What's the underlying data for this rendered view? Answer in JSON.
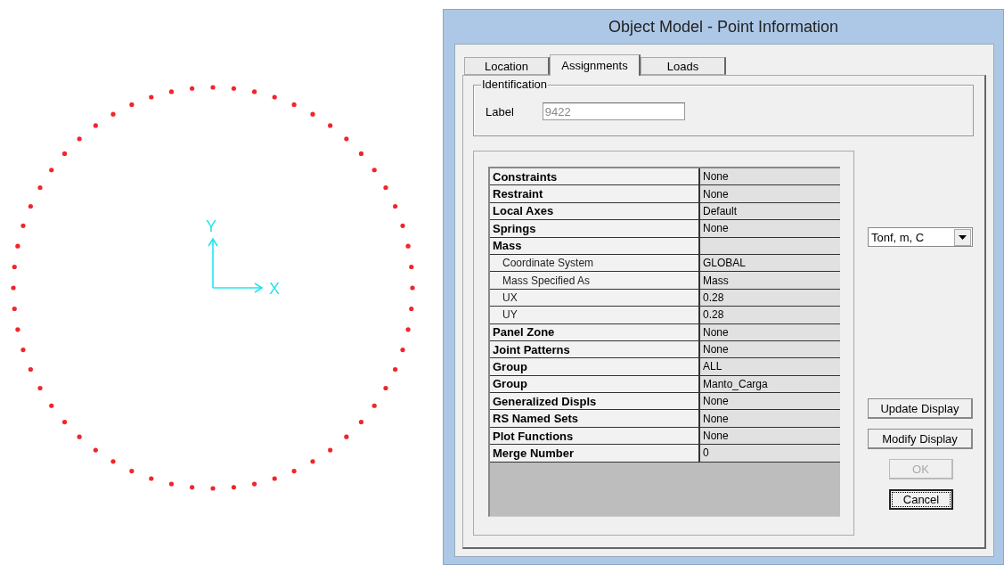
{
  "canvas": {
    "axes": {
      "y_label": "Y",
      "x_label": "X"
    }
  },
  "window": {
    "title": "Object Model - Point Information"
  },
  "tabs": [
    {
      "label": "Location",
      "selected": false
    },
    {
      "label": "Assignments",
      "selected": true
    },
    {
      "label": "Loads",
      "selected": false
    }
  ],
  "identification": {
    "title": "Identification",
    "label": "Label",
    "value": "9422",
    "disabled": true
  },
  "table": {
    "rows": [
      {
        "kind": "header",
        "name": "Constraints",
        "value": "None"
      },
      {
        "kind": "header",
        "name": "Restraint",
        "value": "None"
      },
      {
        "kind": "header",
        "name": "Local Axes",
        "value": "Default"
      },
      {
        "kind": "header",
        "name": "Springs",
        "value": "None"
      },
      {
        "kind": "header",
        "name": "Mass"
      },
      {
        "kind": "sub",
        "name": "Coordinate System",
        "value": "GLOBAL"
      },
      {
        "kind": "sub",
        "name": "Mass Specified As",
        "value": "Mass"
      },
      {
        "kind": "sub",
        "name": "UX",
        "value": "0.28"
      },
      {
        "kind": "sub",
        "name": "UY",
        "value": "0.28"
      },
      {
        "kind": "header",
        "name": "Panel Zone",
        "value": "None"
      },
      {
        "kind": "header",
        "name": "Joint Patterns",
        "value": "None"
      },
      {
        "kind": "header",
        "name": "Group",
        "value": "ALL"
      },
      {
        "kind": "header",
        "name": "Group",
        "value": "Manto_Carga"
      },
      {
        "kind": "header",
        "name": "Generalized Displs",
        "value": "None"
      },
      {
        "kind": "header",
        "name": "RS Named Sets",
        "value": "None"
      },
      {
        "kind": "header",
        "name": "Plot Functions",
        "value": "None"
      },
      {
        "kind": "header",
        "name": "Merge Number",
        "value": "0"
      }
    ]
  },
  "units": {
    "value": "Tonf, m, C"
  },
  "buttons": [
    {
      "label": "Update Display",
      "kind": "wide",
      "disabled": false,
      "focused": false
    },
    {
      "label": "Modify Display",
      "kind": "wide",
      "disabled": false,
      "focused": false
    },
    {
      "label": "OK",
      "kind": "narrow",
      "disabled": true,
      "focused": false
    },
    {
      "label": "Cancel",
      "kind": "narrow",
      "disabled": false,
      "focused": true
    }
  ]
}
